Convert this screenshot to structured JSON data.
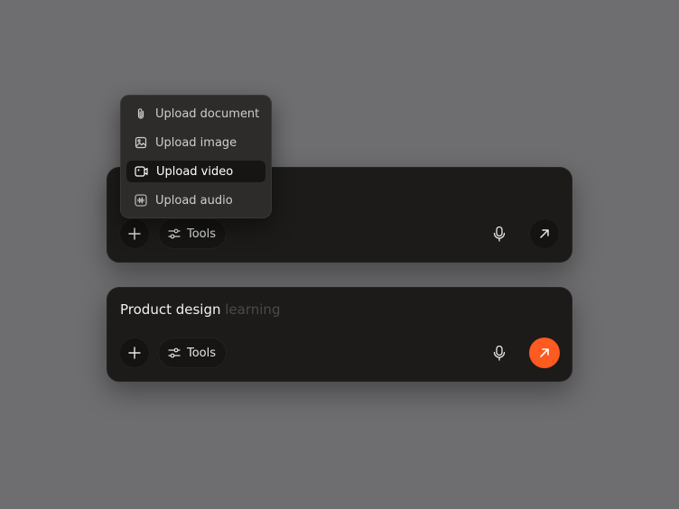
{
  "menu": {
    "items": [
      {
        "label": "Upload document",
        "icon": "paperclip-icon"
      },
      {
        "label": "Upload image",
        "icon": "image-icon"
      },
      {
        "label": "Upload video",
        "icon": "video-icon",
        "selected": true
      },
      {
        "label": "Upload audio",
        "icon": "audio-wave-icon"
      }
    ]
  },
  "composer_top": {
    "tools_label": "Tools"
  },
  "composer_bottom": {
    "prompt_text": "Product design",
    "prompt_suggestion": "learning",
    "tools_label": "Tools"
  },
  "colors": {
    "background": "#6e6e70",
    "panel": "#1c1b1a",
    "accent": "#ff5a1f",
    "menu": "#2e2c2a"
  }
}
